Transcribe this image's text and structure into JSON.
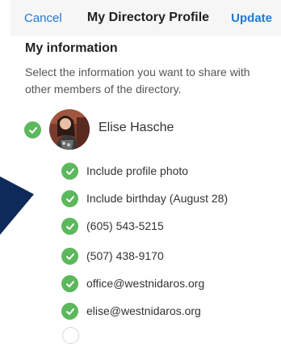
{
  "navbar": {
    "cancel_label": "Cancel",
    "title": "My Directory Profile",
    "update_label": "Update"
  },
  "section": {
    "heading": "My information",
    "description": "Select the information you want to share with other members of the directory."
  },
  "member": {
    "name": "Elise Hasche",
    "selected": true
  },
  "options": [
    {
      "label": "Include profile photo",
      "checked": true
    },
    {
      "label": "Include birthday (August 28)",
      "checked": true
    },
    {
      "label": "(605) 543-5215",
      "checked": true
    },
    {
      "label": "(507) 438-9170",
      "checked": true
    },
    {
      "label": "office@westnidaros.org",
      "checked": true
    },
    {
      "label": "elise@westnidaros.org",
      "checked": true
    }
  ],
  "colors": {
    "accent": "#1f7ad1",
    "check": "#5cb85c",
    "navy": "#0e2a5a"
  },
  "icons": {
    "check": "checkmark-circle-icon"
  }
}
